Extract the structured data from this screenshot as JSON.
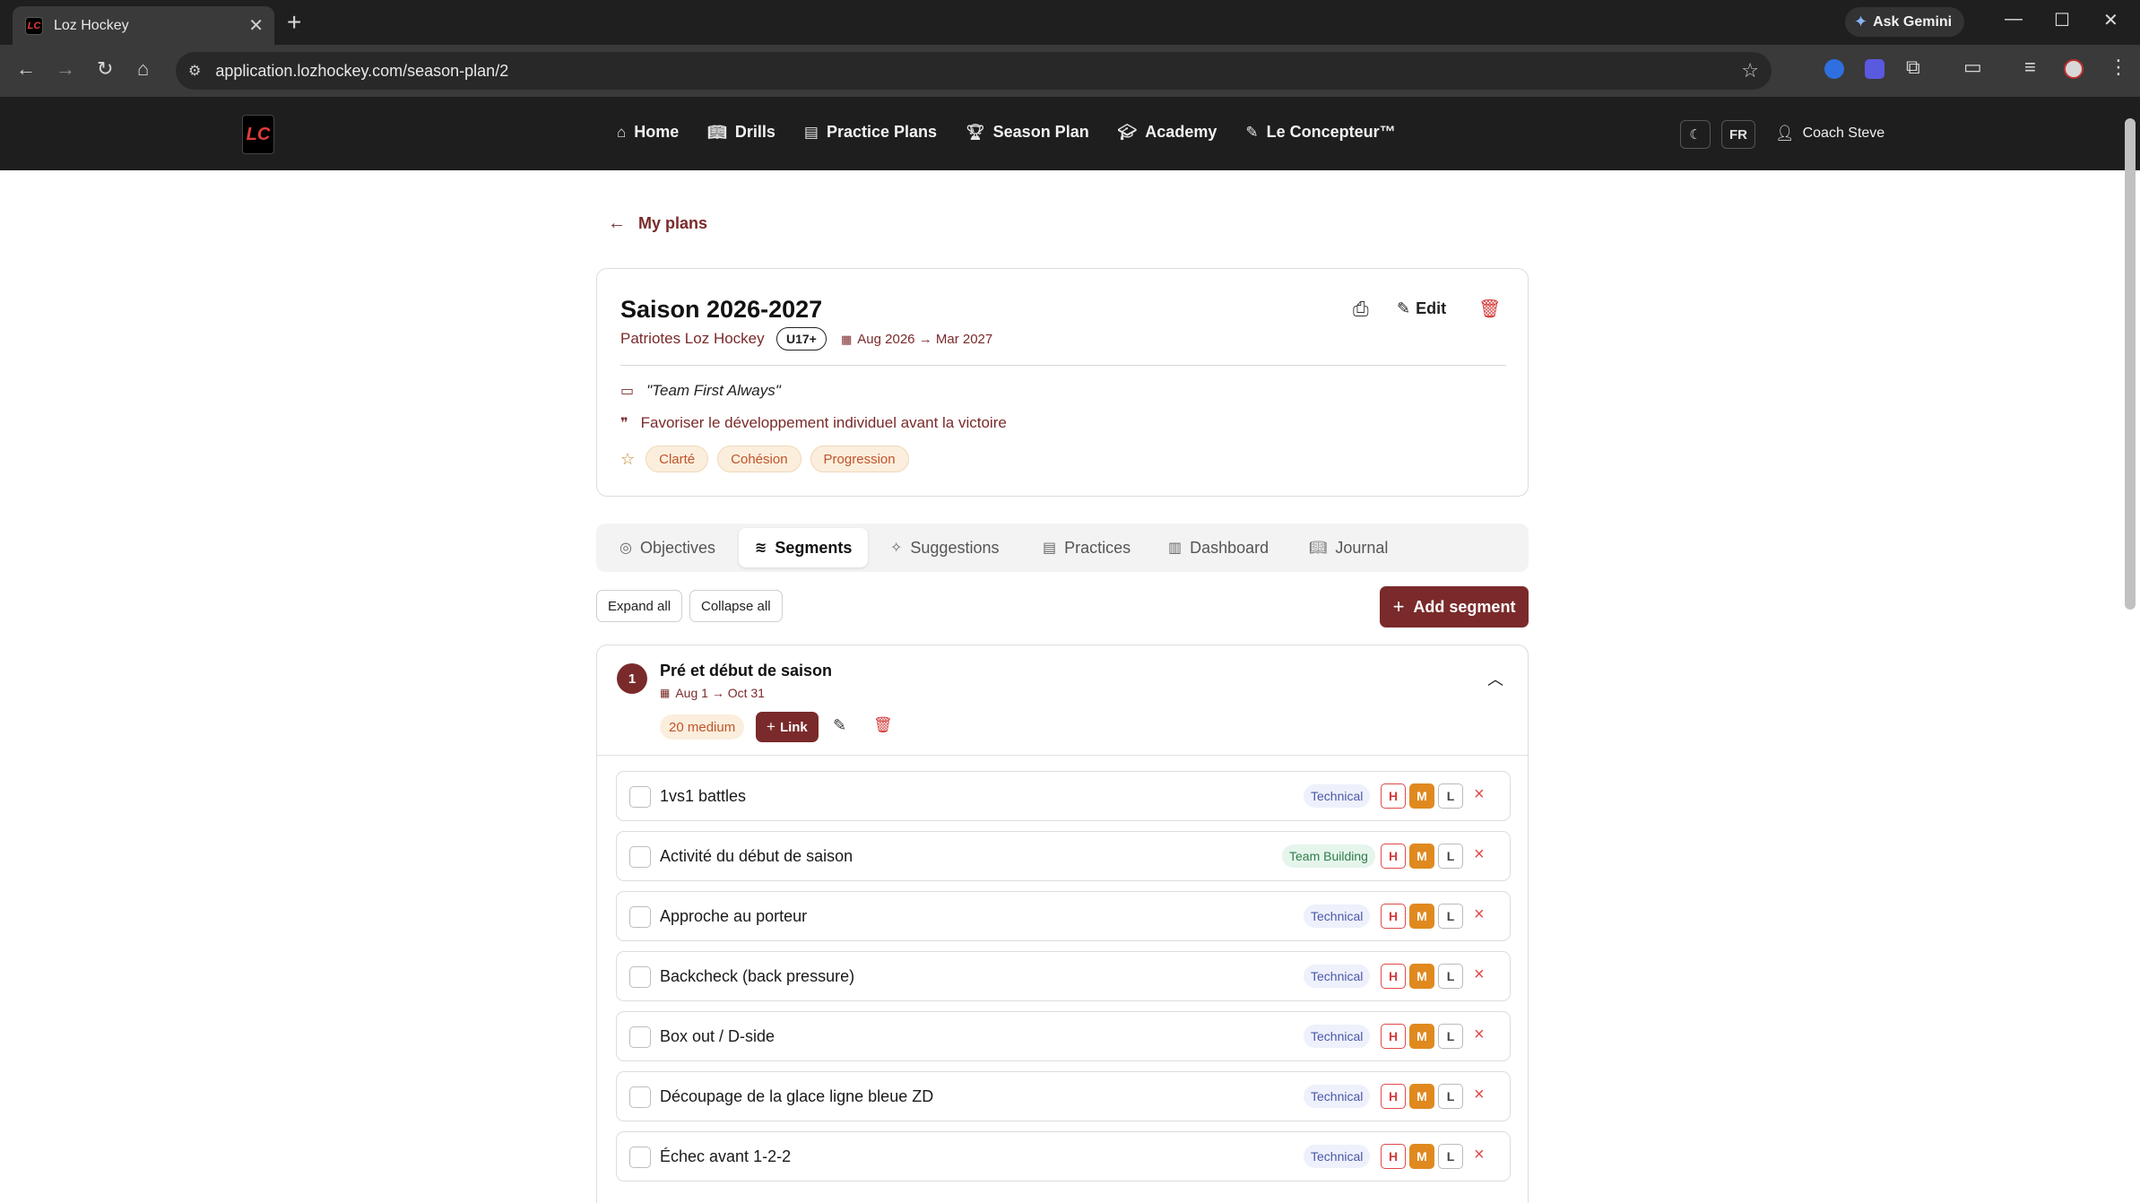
{
  "browser": {
    "tab_title": "Loz Hockey",
    "url": "application.lozhockey.com/season-plan/2",
    "gemini_label": "Ask Gemini"
  },
  "header": {
    "logo_text": "LC",
    "nav": [
      {
        "label": "Home",
        "icon": "home-icon"
      },
      {
        "label": "Drills",
        "icon": "book-icon"
      },
      {
        "label": "Practice Plans",
        "icon": "clipboard-icon"
      },
      {
        "label": "Season Plan",
        "icon": "trophy-icon"
      },
      {
        "label": "Academy",
        "icon": "graduation-cap-icon"
      },
      {
        "label": "Le Concepteur™",
        "icon": "pencil-icon"
      }
    ],
    "lang": "FR",
    "user": "Coach Steve"
  },
  "back_link": "My plans",
  "plan": {
    "title": "Saison 2026-2027",
    "team": "Patriotes Loz Hockey",
    "age_group": "U17+",
    "dates": "Aug 2026 → Mar 2027",
    "edit_label": "Edit",
    "motto": "\"Team First Always\"",
    "philosophy": "Favoriser le développement individuel avant la victoire",
    "values": [
      "Clarté",
      "Cohésion",
      "Progression"
    ]
  },
  "tabs": [
    {
      "label": "Objectives",
      "icon": "target-icon"
    },
    {
      "label": "Segments",
      "icon": "layers-icon"
    },
    {
      "label": "Suggestions",
      "icon": "sparkles-icon"
    },
    {
      "label": "Practices",
      "icon": "clipboard-icon"
    },
    {
      "label": "Dashboard",
      "icon": "bar-chart-icon"
    },
    {
      "label": "Journal",
      "icon": "book-open-icon"
    }
  ],
  "active_tab": "Segments",
  "actions": {
    "expand_all": "Expand all",
    "collapse_all": "Collapse all",
    "add_segment": "Add segment"
  },
  "segment": {
    "number": "1",
    "title": "Pré et début de saison",
    "dates": "Aug 1 → Oct 31",
    "intensity": "20 medium",
    "link_label": "Link",
    "drills": [
      {
        "name": "1vs1 battles",
        "category": "Technical",
        "intensity": "M"
      },
      {
        "name": "Activité du début de saison",
        "category": "Team Building",
        "intensity": "M"
      },
      {
        "name": "Approche au porteur",
        "category": "Technical",
        "intensity": "M"
      },
      {
        "name": "Backcheck (back pressure)",
        "category": "Technical",
        "intensity": "M"
      },
      {
        "name": "Box out / D-side",
        "category": "Technical",
        "intensity": "M"
      },
      {
        "name": "Découpage de la glace ligne bleue ZD",
        "category": "Technical",
        "intensity": "M"
      },
      {
        "name": "Échec avant 1-2-2",
        "category": "Technical",
        "intensity": "M"
      }
    ],
    "intensity_levels": [
      "H",
      "M",
      "L"
    ]
  },
  "colors": {
    "brand": "#7a2a2a",
    "medium": "#e0891f",
    "high": "#e04848"
  }
}
